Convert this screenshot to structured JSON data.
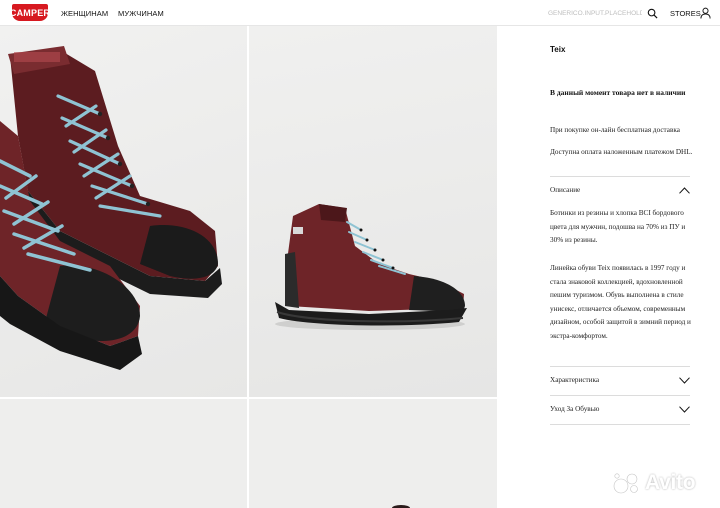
{
  "header": {
    "logo_text": "CAMPER",
    "nav": [
      {
        "label": "ЖЕНЩИНАМ"
      },
      {
        "label": "МУЖЧИНАМ"
      }
    ],
    "search_placeholder": "GENERICO.INPUT.PLACEHOLDER",
    "stores_label": "STORES",
    "brand_color": "#d71920"
  },
  "gallery": {
    "images": [
      {
        "icon": "boot-closeup-image"
      },
      {
        "icon": "boot-side-image"
      },
      {
        "icon": "boot-image"
      },
      {
        "icon": "boot-image"
      }
    ],
    "boot_upper_color": "#6e2428",
    "lace_color": "#8fc3d3",
    "sole_color": "#1c1c1c"
  },
  "product": {
    "name": "Teix",
    "stock_message": "В данный момент товара нет в наличии",
    "info": [
      "При покупке он-лайн бесплатная доставка",
      "Доступна оплата наложенным платежом DHL."
    ]
  },
  "accordions": {
    "description": {
      "title": "Описание",
      "paragraph_1": "Ботинки из резины и хлопка BCI бордового цвета для мужчин, подошва на 70% из ПУ и 30% из резины.",
      "paragraph_2": "Линейка обуви Teix появилась в 1997 году и стала знаковой коллекцией, вдохновленной пешим туризмом. Обувь выполнена в стиле унисекс, отличается объемом, современным дизайном, особой защитой в зимний период и экстра-комфортом."
    },
    "characteristics": {
      "title": "Характеристика"
    },
    "care": {
      "title": "Уход За Обувью"
    }
  },
  "watermark": {
    "text": "Avito"
  }
}
